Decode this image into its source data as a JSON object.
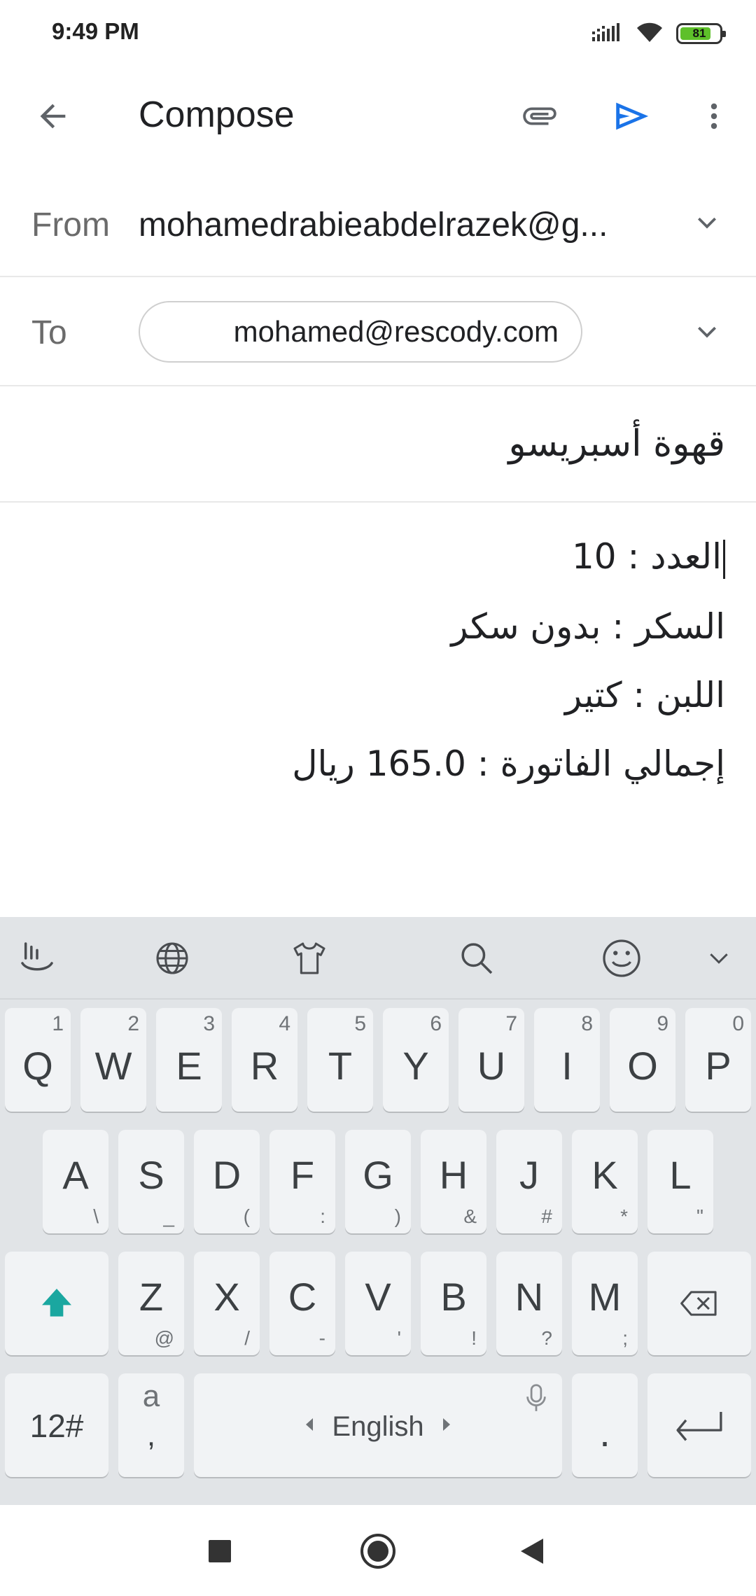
{
  "status_bar": {
    "time": "9:49 PM",
    "battery_level": "81",
    "battery_fraction": 0.81,
    "icons": [
      "signal-icon",
      "wifi-icon",
      "battery-icon"
    ]
  },
  "app_bar": {
    "title": "Compose",
    "icons": [
      "back-arrow-icon",
      "attach-icon",
      "send-icon",
      "more-vert-icon"
    ],
    "accent_color": "#1a73e8"
  },
  "from": {
    "label": "From",
    "value": "mohamedrabieabdelrazek@g..."
  },
  "to": {
    "label": "To",
    "chip": "mohamed@rescody.com"
  },
  "subject": {
    "value": "قهوة أسبريسو"
  },
  "body": {
    "lines": [
      "العدد  : 10",
      "السكر  : بدون سكر",
      "اللبن  : كتير",
      "إجمالي الفاتورة : 165.0 ريال"
    ]
  },
  "keyboard": {
    "toolbar_icons": [
      "touchpal-icon",
      "globe-icon",
      "theme-shirt-icon",
      "search-icon",
      "emoji-icon",
      "collapse-chevron-icon"
    ],
    "row1": [
      {
        "key": "Q",
        "hint": "1"
      },
      {
        "key": "W",
        "hint": "2"
      },
      {
        "key": "E",
        "hint": "3"
      },
      {
        "key": "R",
        "hint": "4"
      },
      {
        "key": "T",
        "hint": "5"
      },
      {
        "key": "Y",
        "hint": "6"
      },
      {
        "key": "U",
        "hint": "7"
      },
      {
        "key": "I",
        "hint": "8"
      },
      {
        "key": "O",
        "hint": "9"
      },
      {
        "key": "P",
        "hint": "0"
      }
    ],
    "row2": [
      {
        "key": "A",
        "hint": "\\"
      },
      {
        "key": "S",
        "hint": "_"
      },
      {
        "key": "D",
        "hint": "("
      },
      {
        "key": "F",
        "hint": ":"
      },
      {
        "key": "G",
        "hint": ")"
      },
      {
        "key": "H",
        "hint": "&"
      },
      {
        "key": "J",
        "hint": "#"
      },
      {
        "key": "K",
        "hint": "*"
      },
      {
        "key": "L",
        "hint": "\""
      }
    ],
    "row3": [
      {
        "key": "Z",
        "hint": "@"
      },
      {
        "key": "X",
        "hint": "/"
      },
      {
        "key": "C",
        "hint": "-"
      },
      {
        "key": "V",
        "hint": "'"
      },
      {
        "key": "B",
        "hint": "!"
      },
      {
        "key": "N",
        "hint": "?"
      },
      {
        "key": "M",
        "hint": ";"
      }
    ],
    "symbols_key": "12#",
    "a_key_top": "a",
    "a_key_bottom": ",",
    "space_label": "English",
    "period_key": ".",
    "shift_color": "#1aa7a0"
  },
  "nav_bar": {
    "icons": [
      "recent-apps-icon",
      "home-icon",
      "back-icon"
    ]
  }
}
